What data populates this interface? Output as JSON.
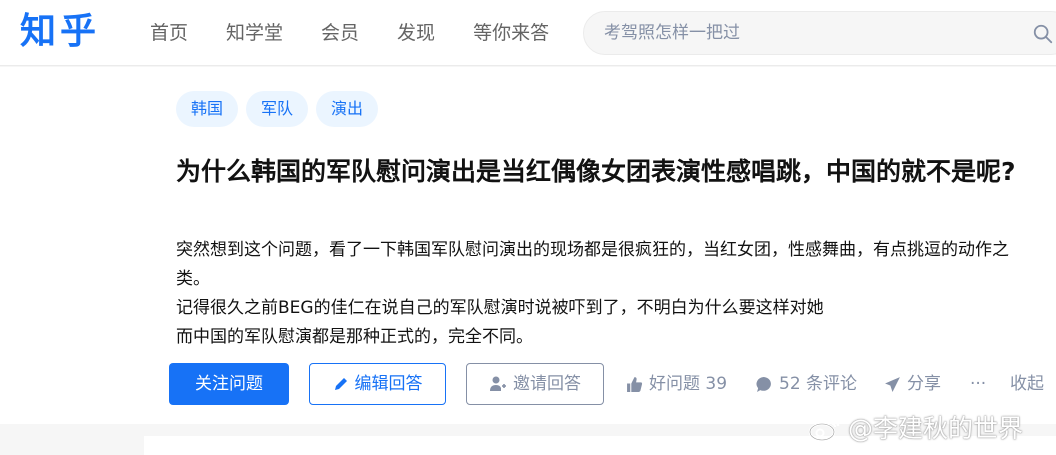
{
  "header": {
    "logo": "知乎",
    "nav": [
      "首页",
      "知学堂",
      "会员",
      "发现",
      "等你来答"
    ],
    "search_placeholder": "考驾照怎样一把过"
  },
  "question": {
    "tags": [
      "韩国",
      "军队",
      "演出"
    ],
    "title": "为什么韩国的军队慰问演出是当红偶像女团表演性感唱跳，中国的就不是呢?",
    "description": [
      "突然想到这个问题，看了一下韩国军队慰问演出的现场都是很疯狂的，当红女团，性感舞曲，有点挑逗的动作之类。",
      "记得很久之前BEG的佳仁在说自己的军队慰演时说被吓到了，不明白为什么要这样对她",
      "而中国的军队慰演都是那种正式的，完全不同。"
    ]
  },
  "actions": {
    "follow": "关注问题",
    "edit_answer": "编辑回答",
    "invite_answer": "邀请回答",
    "good_question": "好问题 39",
    "comments": "52 条评论",
    "share": "分享",
    "more": "···",
    "collapse": "收起"
  },
  "watermark": "@李建秋的世界",
  "colors": {
    "brand": "#1772f6",
    "muted": "#8590a6"
  }
}
